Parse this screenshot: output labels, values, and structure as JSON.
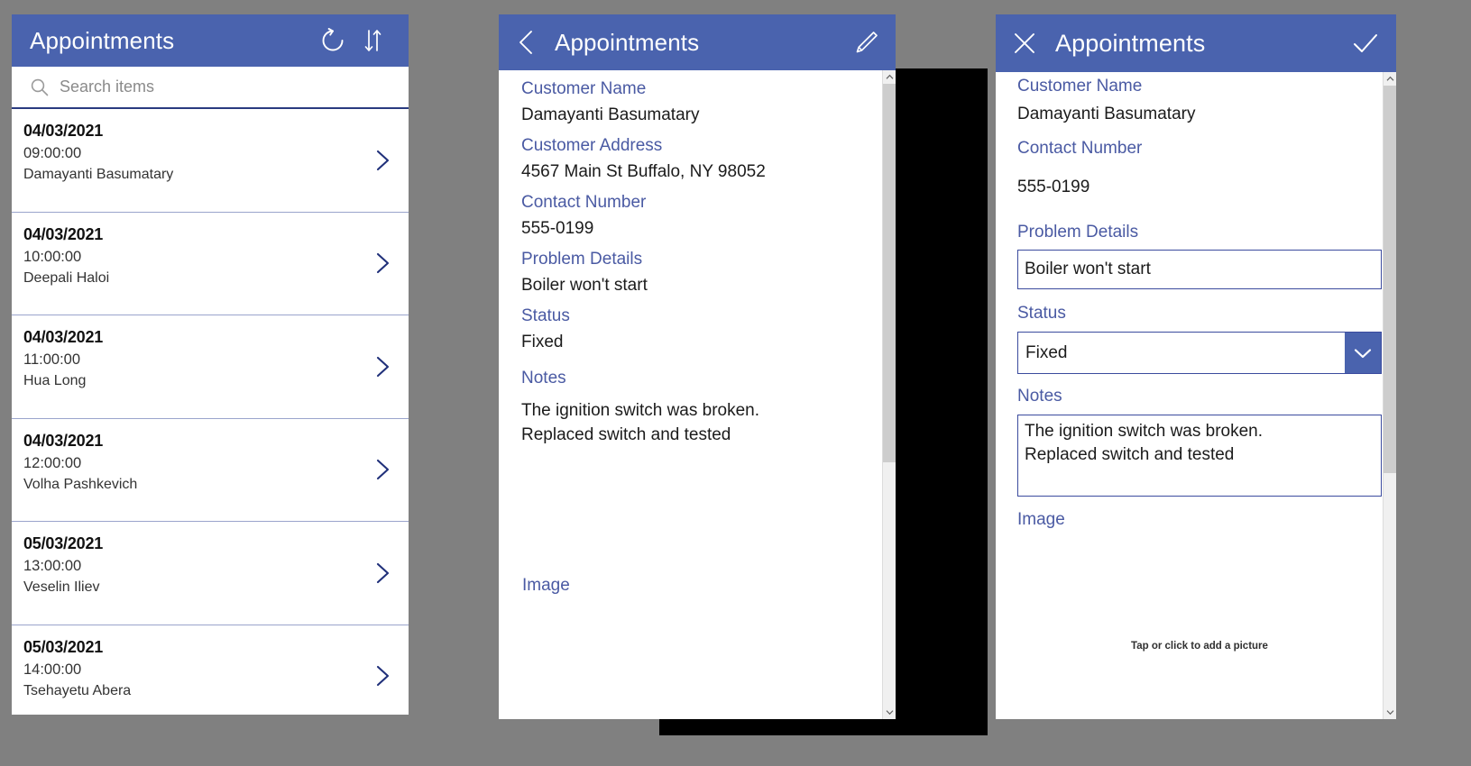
{
  "theme": {
    "accent": "#4a63ae",
    "label_blue": "#4a5aa3",
    "field_border": "#3b4b9e",
    "desktop_bg": "#808080",
    "divider": "#9aa4cc"
  },
  "list_panel": {
    "title": "Appointments",
    "icons": {
      "refresh": "refresh-icon",
      "sort": "sort-icon"
    },
    "search": {
      "placeholder": "Search items",
      "value": "",
      "icon": "search-icon"
    },
    "items": [
      {
        "date": "04/03/2021",
        "time": "09:00:00",
        "name": "Damayanti Basumatary"
      },
      {
        "date": "04/03/2021",
        "time": "10:00:00",
        "name": "Deepali Haloi"
      },
      {
        "date": "04/03/2021",
        "time": "11:00:00",
        "name": "Hua Long"
      },
      {
        "date": "04/03/2021",
        "time": "12:00:00",
        "name": "Volha Pashkevich"
      },
      {
        "date": "05/03/2021",
        "time": "13:00:00",
        "name": "Veselin Iliev"
      },
      {
        "date": "05/03/2021",
        "time": "14:00:00",
        "name": "Tsehayetu Abera"
      }
    ]
  },
  "view_panel": {
    "title": "Appointments",
    "icons": {
      "back": "back-chevron-icon",
      "edit": "pencil-icon"
    },
    "fields": [
      {
        "label": "Customer Name",
        "value": "Damayanti Basumatary"
      },
      {
        "label": "Customer Address",
        "value": "4567 Main St Buffalo, NY 98052"
      },
      {
        "label": "Contact Number",
        "value": "555-0199"
      },
      {
        "label": "Problem Details",
        "value": "Boiler won't start"
      },
      {
        "label": "Status",
        "value": "Fixed"
      },
      {
        "label": "Notes",
        "value": "The ignition switch was broken.\nReplaced switch and tested"
      }
    ],
    "image_label": "Image"
  },
  "edit_panel": {
    "title": "Appointments",
    "icons": {
      "close": "close-icon",
      "confirm": "checkmark-icon",
      "dropdown": "chevron-down-icon"
    },
    "customer_name": {
      "label": "Customer Name",
      "value": "Damayanti Basumatary"
    },
    "contact_number": {
      "label": "Contact Number",
      "value": "555-0199"
    },
    "problem_details": {
      "label": "Problem Details",
      "value": "Boiler won't start"
    },
    "status": {
      "label": "Status",
      "value": "Fixed"
    },
    "notes": {
      "label": "Notes",
      "value": "The ignition switch was broken.\nReplaced switch and tested"
    },
    "image": {
      "label": "Image",
      "hint": "Tap or click to add a picture"
    }
  }
}
